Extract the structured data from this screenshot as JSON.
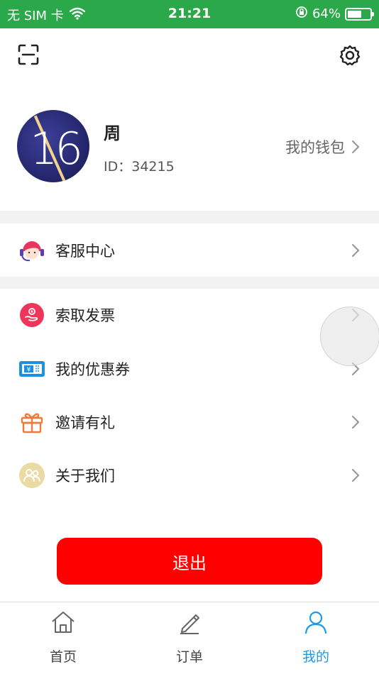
{
  "status_bar": {
    "carrier": "无 SIM 卡",
    "time": "21:21",
    "battery_percent": "64%",
    "battery_level": 0.64
  },
  "header": {
    "scan_icon": "scan-icon",
    "settings_icon": "gear-icon"
  },
  "profile": {
    "avatar_text": "16",
    "name": "周",
    "id_text": "ID：34215",
    "wallet_label": "我的钱包"
  },
  "menu": {
    "customer_service": "客服中心",
    "invoice": "索取发票",
    "coupons": "我的优惠券",
    "invite": "邀请有礼",
    "about": "关于我们"
  },
  "logout_label": "退出",
  "tabbar": {
    "home": "首页",
    "orders": "订单",
    "mine": "我的"
  },
  "colors": {
    "status_bar": "#2ba84a",
    "logout": "#ff0000",
    "active_tab": "#1d9be8"
  }
}
